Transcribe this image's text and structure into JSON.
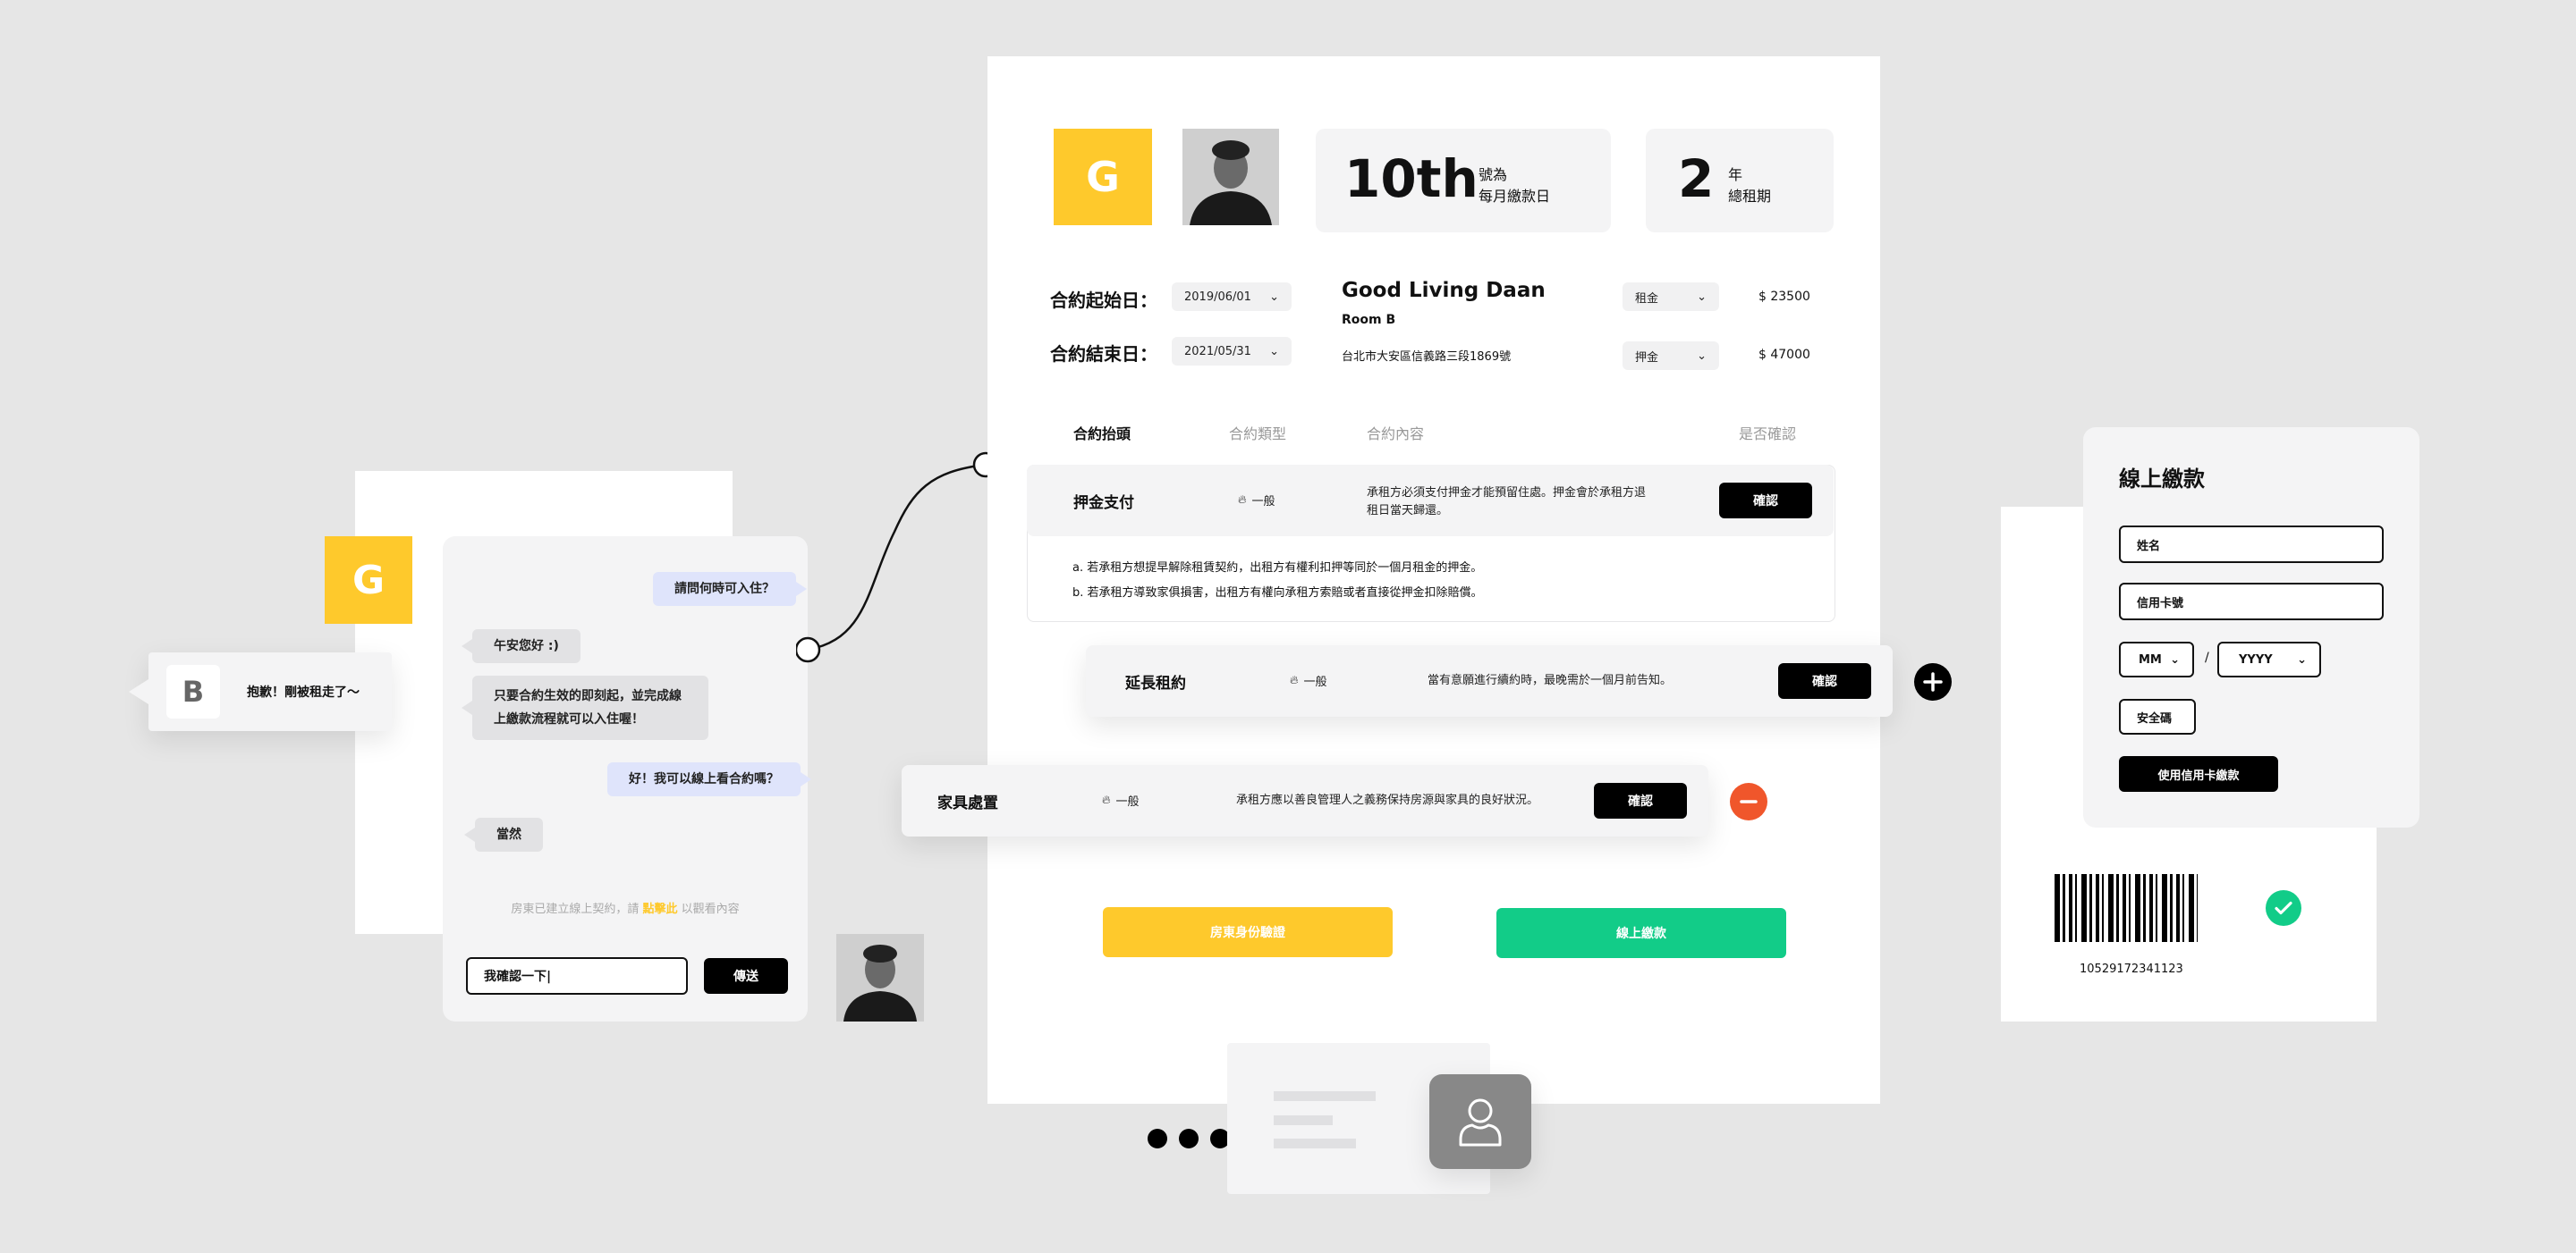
{
  "chat": {
    "b_avatar": "B",
    "b_message": "抱歉！剛被租走了～",
    "g_avatar": "G",
    "messages": [
      {
        "side": "right",
        "text": "請問何時可入住？"
      },
      {
        "side": "left",
        "text": "午安您好 :)"
      },
      {
        "side": "left",
        "text": "只要合約生效的即刻起，並完成線上繳款流程就可以入住喔！"
      },
      {
        "side": "right",
        "text": "好！我可以線上看合約嗎？"
      },
      {
        "side": "left",
        "text": "當然"
      }
    ],
    "system_note_prefix": "房東已建立線上契約，請 ",
    "system_note_link": "點擊此",
    "system_note_suffix": " 以觀看內容",
    "input_value": "我確認一下|",
    "send_label": "傳送"
  },
  "contract": {
    "logo": "G",
    "pay_day": {
      "big": "10th",
      "line1": "號為",
      "line2": "每月繳款日"
    },
    "term": {
      "big": "2",
      "line1": "年",
      "line2": "總租期"
    },
    "start_label": "合約起始日：",
    "start_value": "2019/06/01",
    "end_label": "合約結束日：",
    "end_value": "2021/05/31",
    "property_name": "Good Living Daan",
    "room": "Room B",
    "address": "台北市大安區信義路三段1869號",
    "fee_rent_label": "租金",
    "fee_rent_value": "$ 23500",
    "fee_deposit_label": "押金",
    "fee_deposit_value": "$ 47000",
    "tabs": [
      "合約抬頭",
      "合約類型",
      "合約內容",
      "是否確認"
    ],
    "rows": [
      {
        "title": "押金支付",
        "type": "一般",
        "desc_line1": "承租方必須支付押金才能預留住處。押金會於承租方退",
        "desc_line2": "租日當天歸還。",
        "confirm": "確認",
        "notes": [
          "a. 若承租方想提早解除租賃契約，出租方有權利扣押等同於一個月租金的押金。",
          "b. 若承租方導致家俱損害，出租方有權向承租方索賠或者直接從押金扣除賠償。"
        ]
      },
      {
        "title": "延長租約",
        "type": "一般",
        "desc": "當有意願進行續約時，最晚需於一個月前告知。",
        "confirm": "確認"
      },
      {
        "title": "家具處置",
        "type": "一般",
        "desc": "承租方應以善良管理人之義務保持房源與家具的良好狀況。",
        "confirm": "確認"
      }
    ],
    "id_verify_label": "房東身份驗證",
    "online_pay_label": "線上繳款"
  },
  "payment": {
    "title": "線上繳款",
    "name_placeholder": "姓名",
    "card_placeholder": "信用卡號",
    "mm": "MM",
    "slash": "/",
    "yyyy": "YYYY",
    "cvv": "安全碼",
    "submit": "使用信用卡繳款",
    "barcode_number": "10529172341123"
  },
  "colors": {
    "brand_yellow": "#fec92c",
    "green": "#12cc88",
    "remove_red": "#f0562b",
    "bubble_blue": "#dfe4fb"
  }
}
